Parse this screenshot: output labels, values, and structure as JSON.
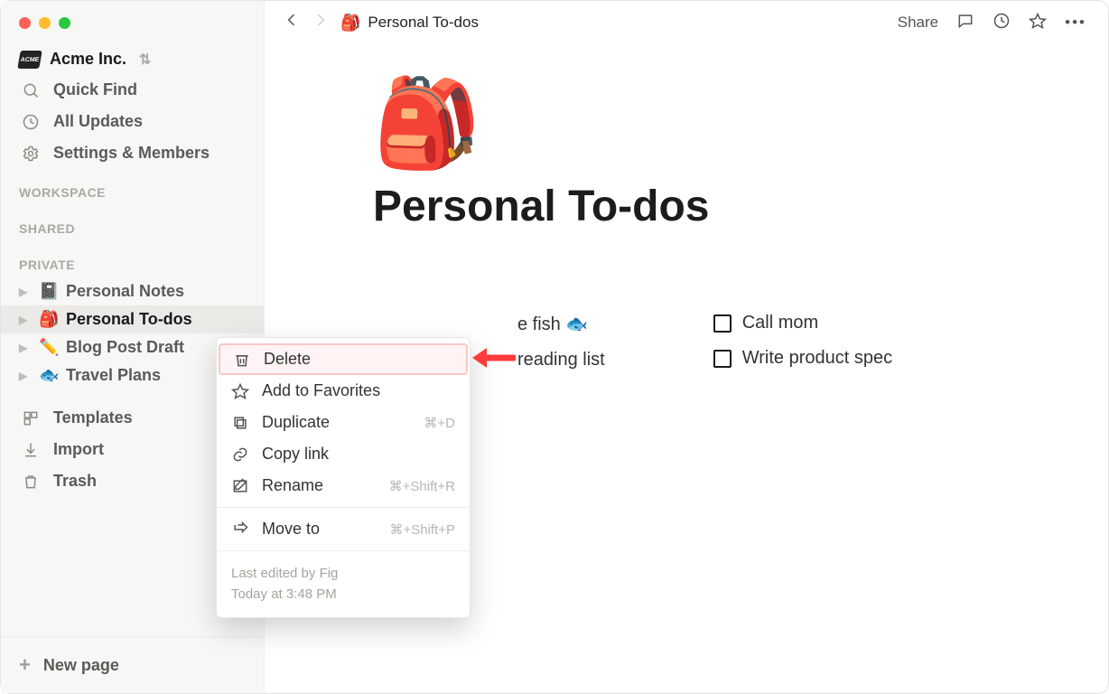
{
  "workspace": {
    "name": "Acme Inc.",
    "logo_text": "ACME"
  },
  "sidebar": {
    "quick_find": "Quick Find",
    "all_updates": "All Updates",
    "settings": "Settings & Members",
    "sections": {
      "workspace": "WORKSPACE",
      "shared": "SHARED",
      "private": "PRIVATE"
    },
    "private_pages": [
      {
        "emoji": "📓",
        "label": "Personal Notes",
        "active": false
      },
      {
        "emoji": "🎒",
        "label": "Personal To-dos",
        "active": true
      },
      {
        "emoji": "✏️",
        "label": "Blog Post Draft",
        "active": false
      },
      {
        "emoji": "🐟",
        "label": "Travel Plans",
        "active": false
      }
    ],
    "templates": "Templates",
    "import": "Import",
    "trash": "Trash",
    "new_page": "New page"
  },
  "breadcrumb": {
    "emoji": "🎒",
    "title": "Personal To-dos"
  },
  "topbar": {
    "share": "Share"
  },
  "page": {
    "emoji": "🎒",
    "title": "Personal To-dos",
    "todos_left": [
      {
        "label_suffix": "e fish 🐟"
      },
      {
        "label_suffix": "reading list"
      }
    ],
    "todos_right": [
      {
        "label": "Call mom"
      },
      {
        "label": "Write product spec"
      }
    ]
  },
  "context_menu": {
    "items": [
      {
        "icon": "trash",
        "label": "Delete",
        "shortcut": "",
        "highlight": true
      },
      {
        "icon": "star",
        "label": "Add to Favorites",
        "shortcut": ""
      },
      {
        "icon": "duplicate",
        "label": "Duplicate",
        "shortcut": "⌘+D"
      },
      {
        "icon": "link",
        "label": "Copy link",
        "shortcut": ""
      },
      {
        "icon": "rename",
        "label": "Rename",
        "shortcut": "⌘+Shift+R"
      },
      {
        "sep": true
      },
      {
        "icon": "move",
        "label": "Move to",
        "shortcut": "⌘+Shift+P"
      }
    ],
    "meta_line1": "Last edited by Fig",
    "meta_line2": "Today at 3:48 PM"
  }
}
